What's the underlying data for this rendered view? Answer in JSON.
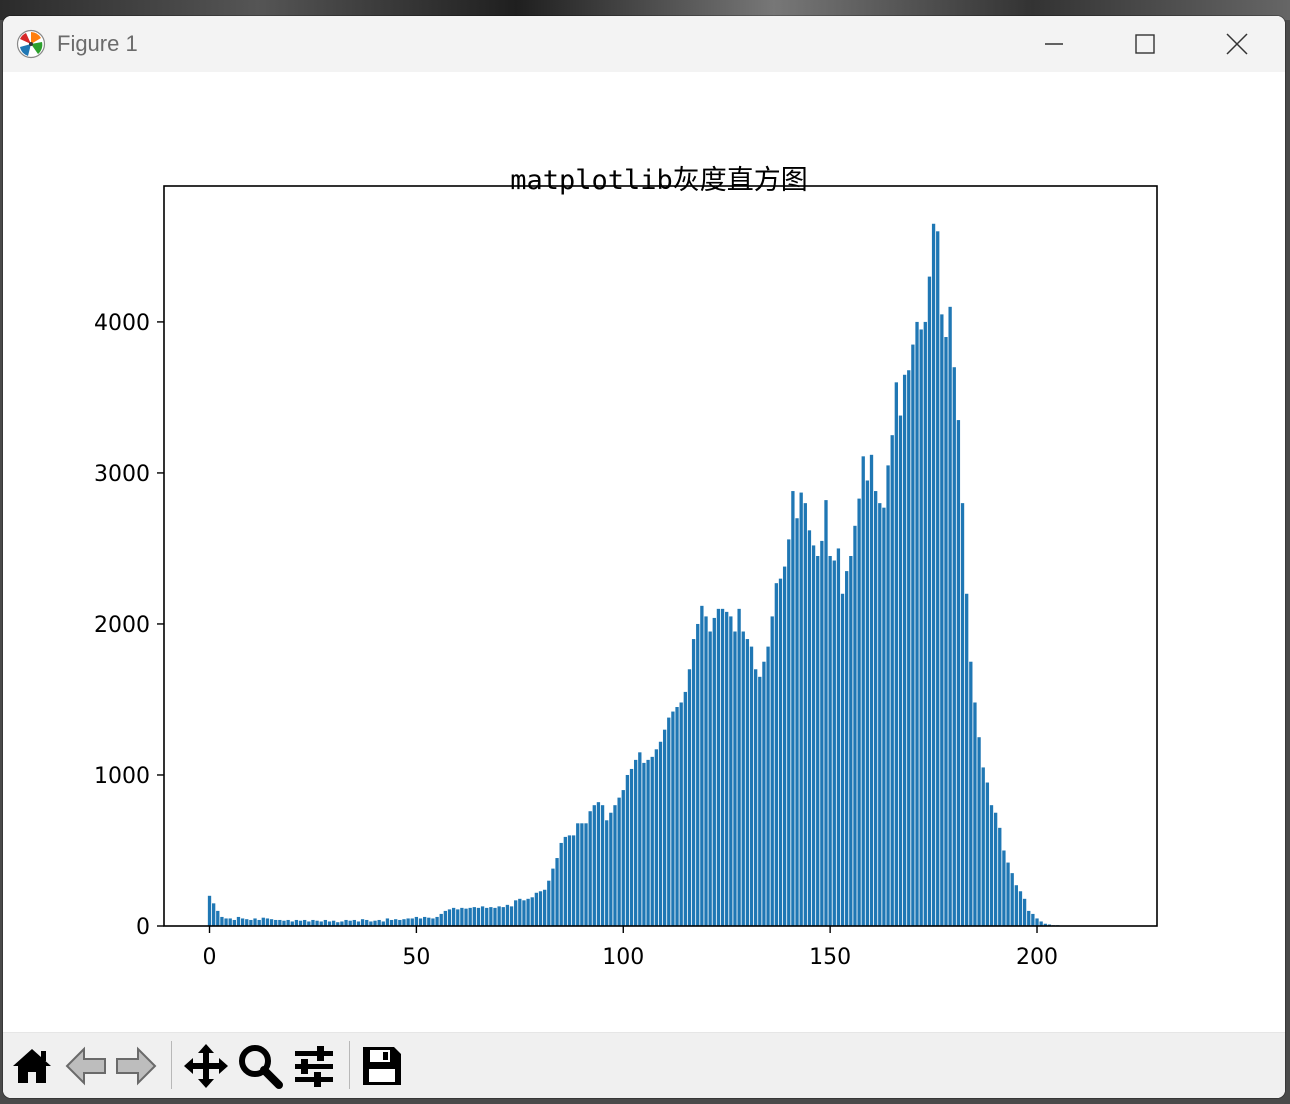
{
  "window": {
    "title": "Figure 1",
    "controls": [
      "minimize-icon",
      "maximize-icon",
      "close-icon"
    ]
  },
  "toolbar": {
    "buttons": [
      "home-icon",
      "back-icon",
      "forward-icon",
      "pan-icon",
      "zoom-icon",
      "configure-subplots-icon",
      "save-icon"
    ]
  },
  "colors": {
    "bar": "#1f77b4",
    "titlebar": "#f3f3f3",
    "toolbar": "#f0f0f0"
  },
  "chart_data": {
    "type": "bar",
    "title": "matplotlib灰度直方图",
    "xlabel": "",
    "ylabel": "",
    "xlim": [
      -11,
      229
    ],
    "ylim": [
      0,
      4900
    ],
    "x_ticks": [
      0,
      50,
      100,
      150,
      200
    ],
    "y_ticks": [
      0,
      1000,
      2000,
      3000,
      4000
    ],
    "x_tick_labels": [
      "0",
      "50",
      "100",
      "150",
      "200"
    ],
    "y_tick_labels": [
      "0",
      "1000",
      "2000",
      "3000",
      "4000"
    ],
    "grid": false,
    "bar_width": 0.8,
    "x": [
      0,
      1,
      2,
      3,
      4,
      5,
      6,
      7,
      8,
      9,
      10,
      11,
      12,
      13,
      14,
      15,
      16,
      17,
      18,
      19,
      20,
      21,
      22,
      23,
      24,
      25,
      26,
      27,
      28,
      29,
      30,
      31,
      32,
      33,
      34,
      35,
      36,
      37,
      38,
      39,
      40,
      41,
      42,
      43,
      44,
      45,
      46,
      47,
      48,
      49,
      50,
      51,
      52,
      53,
      54,
      55,
      56,
      57,
      58,
      59,
      60,
      61,
      62,
      63,
      64,
      65,
      66,
      67,
      68,
      69,
      70,
      71,
      72,
      73,
      74,
      75,
      76,
      77,
      78,
      79,
      80,
      81,
      82,
      83,
      84,
      85,
      86,
      87,
      88,
      89,
      90,
      91,
      92,
      93,
      94,
      95,
      96,
      97,
      98,
      99,
      100,
      101,
      102,
      103,
      104,
      105,
      106,
      107,
      108,
      109,
      110,
      111,
      112,
      113,
      114,
      115,
      116,
      117,
      118,
      119,
      120,
      121,
      122,
      123,
      124,
      125,
      126,
      127,
      128,
      129,
      130,
      131,
      132,
      133,
      134,
      135,
      136,
      137,
      138,
      139,
      140,
      141,
      142,
      143,
      144,
      145,
      146,
      147,
      148,
      149,
      150,
      151,
      152,
      153,
      154,
      155,
      156,
      157,
      158,
      159,
      160,
      161,
      162,
      163,
      164,
      165,
      166,
      167,
      168,
      169,
      170,
      171,
      172,
      173,
      174,
      175,
      176,
      177,
      178,
      179,
      180,
      181,
      182,
      183,
      184,
      185,
      186,
      187,
      188,
      189,
      190,
      191,
      192,
      193,
      194,
      195,
      196,
      197,
      198,
      199,
      200,
      201,
      202,
      203,
      204,
      205,
      206,
      207,
      208,
      209,
      210,
      211,
      212,
      213,
      214,
      215,
      216,
      217,
      218
    ],
    "values": [
      200,
      150,
      100,
      60,
      50,
      50,
      40,
      60,
      50,
      45,
      40,
      50,
      40,
      55,
      50,
      45,
      40,
      40,
      35,
      40,
      30,
      40,
      35,
      40,
      30,
      40,
      35,
      30,
      40,
      30,
      35,
      25,
      30,
      40,
      35,
      40,
      30,
      45,
      40,
      30,
      35,
      40,
      30,
      50,
      40,
      45,
      40,
      45,
      50,
      50,
      60,
      50,
      60,
      55,
      50,
      60,
      80,
      100,
      110,
      120,
      110,
      120,
      115,
      120,
      125,
      120,
      130,
      120,
      125,
      120,
      130,
      125,
      140,
      130,
      170,
      180,
      170,
      180,
      190,
      220,
      230,
      240,
      300,
      380,
      450,
      550,
      590,
      600,
      600,
      680,
      680,
      680,
      760,
      800,
      820,
      800,
      700,
      750,
      800,
      850,
      900,
      1000,
      1040,
      1100,
      1150,
      1080,
      1100,
      1120,
      1170,
      1220,
      1300,
      1380,
      1420,
      1450,
      1480,
      1550,
      1700,
      1900,
      2000,
      2120,
      2050,
      1950,
      2040,
      2100,
      2100,
      2080,
      2050,
      1950,
      2100,
      1950,
      1900,
      1850,
      1700,
      1650,
      1750,
      1850,
      2050,
      2270,
      2300,
      2380,
      2560,
      2880,
      2700,
      2870,
      2800,
      2620,
      2520,
      2450,
      2550,
      2820,
      2450,
      2420,
      2500,
      2200,
      2350,
      2450,
      2650,
      2830,
      3110,
      2950,
      3120,
      2880,
      2800,
      2770,
      3050,
      3250,
      3600,
      3380,
      3650,
      3680,
      3850,
      4000,
      3950,
      4000,
      4300,
      4650,
      4600,
      4050,
      3900,
      4100,
      3700,
      3350,
      2800,
      2200,
      1750,
      1480,
      1250,
      1050,
      950,
      800,
      750,
      650,
      500,
      420,
      350,
      270,
      230,
      180,
      100,
      80,
      50,
      30,
      15,
      10,
      5,
      5,
      3,
      2,
      1,
      1,
      0
    ]
  }
}
